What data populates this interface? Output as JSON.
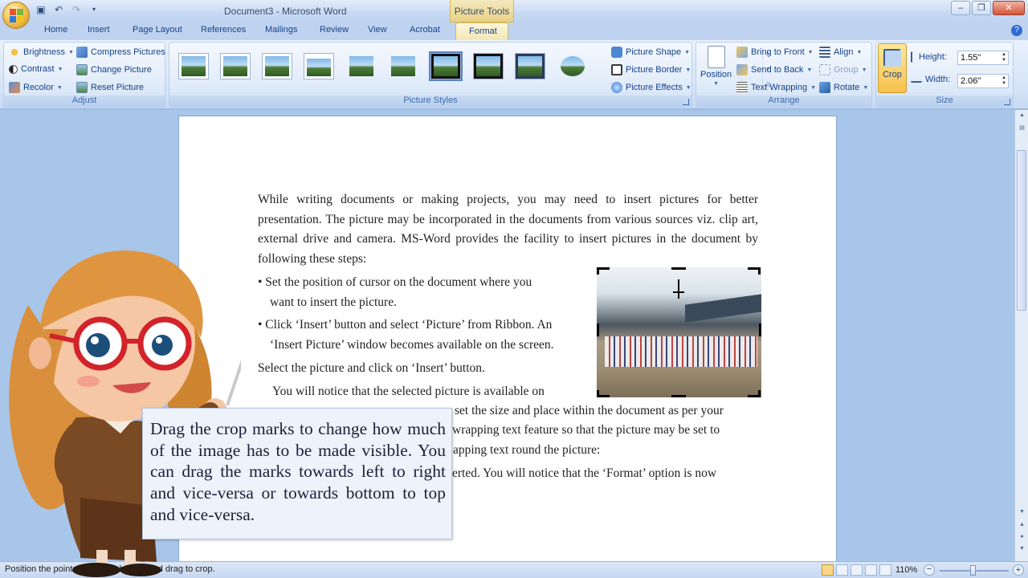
{
  "window": {
    "title": "Document3 - Microsoft Word",
    "context_tab_group": "Picture Tools"
  },
  "tabs": [
    "Home",
    "Insert",
    "Page Layout",
    "References",
    "Mailings",
    "Review",
    "View",
    "Acrobat",
    "Format"
  ],
  "active_tab": "Format",
  "ribbon": {
    "adjust": {
      "label": "Adjust",
      "brightness": "Brightness",
      "contrast": "Contrast",
      "recolor": "Recolor",
      "compress": "Compress Pictures",
      "change": "Change Picture",
      "reset": "Reset Picture"
    },
    "picture_styles": {
      "label": "Picture Styles",
      "shape": "Picture Shape",
      "border": "Picture Border",
      "effects": "Picture Effects"
    },
    "arrange": {
      "label": "Arrange",
      "position": "Position",
      "bring_front": "Bring to Front",
      "send_back": "Send to Back",
      "text_wrapping": "Text Wrapping",
      "align": "Align",
      "group": "Group",
      "rotate": "Rotate"
    },
    "size": {
      "label": "Size",
      "crop": "Crop",
      "height_label": "Height:",
      "height_value": "1.55\"",
      "width_label": "Width:",
      "width_value": "2.06\""
    }
  },
  "document": {
    "intro_paragraph": "While writing documents or making projects, you may need to insert pictures for better presentation. The picture may be incorporated in the documents from various sources viz. clip art, external drive and camera. MS-Word provides the facility to insert pictures in the document by following these steps:",
    "bullet1_line1": "•  Set the position of cursor on the document where you",
    "bullet1_line2": "want to insert the picture.",
    "bullet2_line1": "• Click ‘Insert’ button and select ‘Picture’ from Ribbon. An",
    "bullet2_line2": "‘Insert Picture’ window becomes available on the screen.",
    "step3": "Select the picture and click on ‘Insert’ button.",
    "notice_line1": "You will notice that the selected picture is available on",
    "notice_line2": "set the size and place within the document as per your",
    "notice_line3": "wrapping text feature so that the picture may be set to",
    "notice_line4": "apping text round the picture:",
    "notice_line5": "erted. You will notice that the ‘Format’ option is now"
  },
  "callout": {
    "text": "Drag the crop marks to change how much of the image has to be made visible. You can drag the marks towards left to right and vice-versa or towards bottom to top and vice-versa."
  },
  "statusbar": {
    "status_text": "Position the pointer over any handle and drag to crop.",
    "zoom": "110%"
  }
}
